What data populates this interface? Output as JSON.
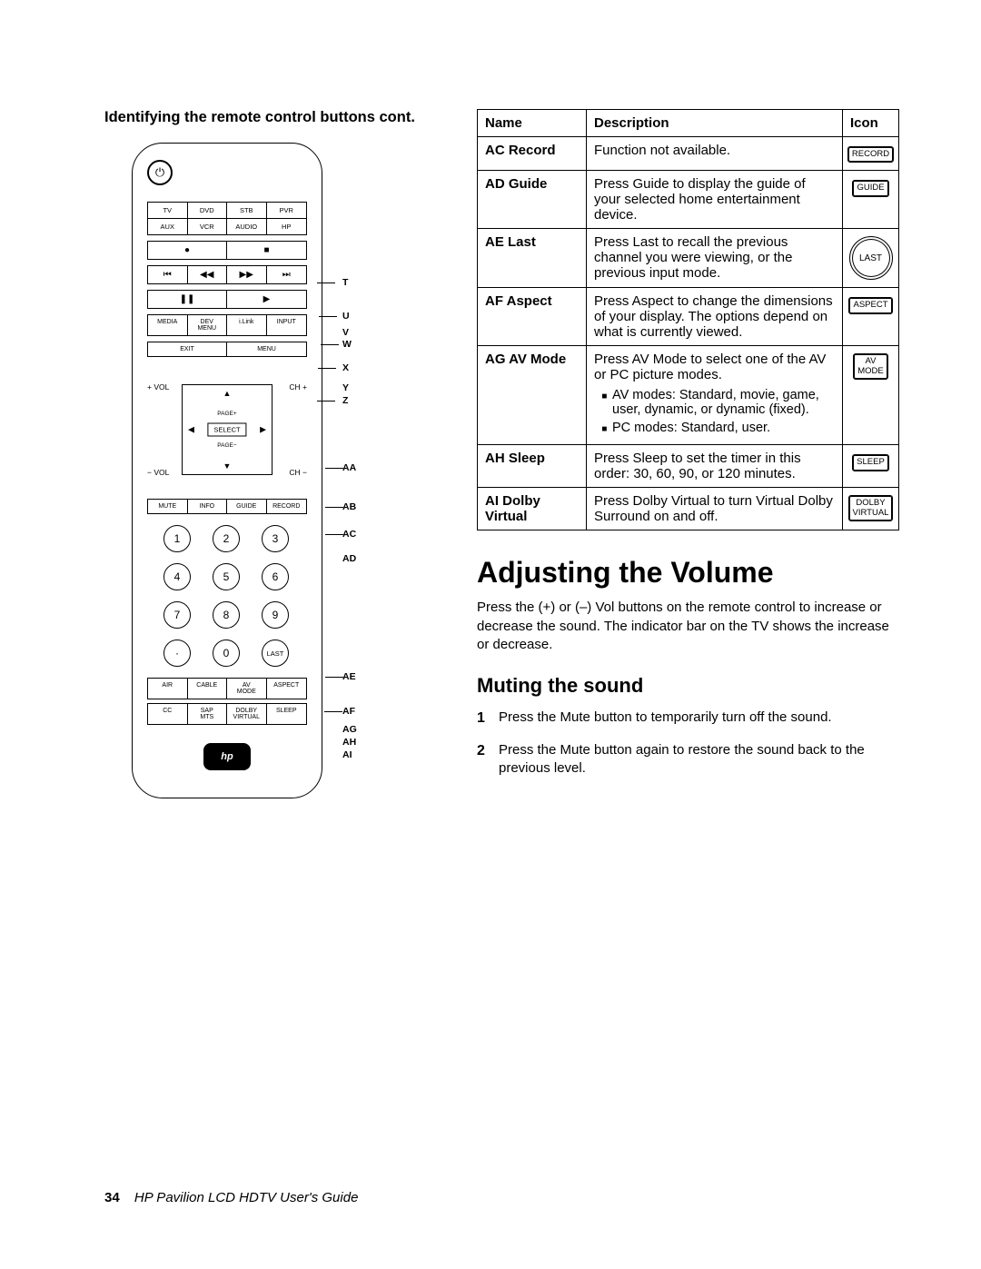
{
  "left": {
    "heading": "Identifying the remote control buttons cont.",
    "device_row1": [
      "TV",
      "DVD",
      "STB",
      "PVR"
    ],
    "device_row2": [
      "AUX",
      "VCR",
      "AUDIO",
      "HP"
    ],
    "rec_stop": [
      "●",
      "■"
    ],
    "transport": [
      "⏮",
      "◀◀",
      "▶▶",
      "⏭"
    ],
    "pause_play": [
      "❚❚",
      "▶"
    ],
    "media_row": [
      "MEDIA",
      "DEV\nMENU",
      "i.Link",
      "INPUT"
    ],
    "exit_menu": [
      "EXIT",
      "MENU"
    ],
    "vol_plus": "+ VOL",
    "vol_minus": "− VOL",
    "ch_plus": "CH +",
    "ch_minus": "CH −",
    "page_plus": "PAGE+",
    "page_minus": "PAGE−",
    "select": "SELECT",
    "info_row": [
      "MUTE",
      "INFO",
      "GUIDE",
      "RECORD"
    ],
    "numbers": [
      "1",
      "2",
      "3",
      "4",
      "5",
      "6",
      "7",
      "8",
      "9",
      "·",
      "0",
      "LAST"
    ],
    "bottom_row1": [
      "AIR",
      "CABLE",
      "AV\nMODE",
      "ASPECT"
    ],
    "bottom_row2": [
      "CC",
      "SAP\nMTS",
      "DOLBY\nVIRTUAL",
      "SLEEP"
    ],
    "callouts": [
      "T",
      "U",
      "V",
      "W",
      "X",
      "Y",
      "Z",
      "AA",
      "AB",
      "AC",
      "AD",
      "AE",
      "AF",
      "AG",
      "AH",
      "AI"
    ]
  },
  "table": {
    "head": [
      "Name",
      "Description",
      "Icon"
    ],
    "rows": [
      {
        "code": "AC",
        "name": "Record",
        "desc": "Function not available.",
        "icon": "RECORD",
        "shape": "rect"
      },
      {
        "code": "AD",
        "name": "Guide",
        "desc": "Press Guide to display the guide of your selected home entertainment device.",
        "icon": "GUIDE",
        "shape": "rect"
      },
      {
        "code": "AE",
        "name": "Last",
        "desc": "Press Last to recall the previous channel you were viewing, or the previous input mode.",
        "icon": "LAST",
        "shape": "circle"
      },
      {
        "code": "AF",
        "name": "Aspect",
        "desc": "Press Aspect to change the dimensions of your display. The options depend on what is currently viewed.",
        "icon": "ASPECT",
        "shape": "rect"
      },
      {
        "code": "AG",
        "name": "AV Mode",
        "desc": "Press AV Mode to select one of the AV or PC picture modes.",
        "icon": "AV\nMODE",
        "shape": "rect",
        "bullets": [
          "AV modes: Standard, movie, game, user, dynamic, or dynamic (fixed).",
          "PC modes: Standard, user."
        ]
      },
      {
        "code": "AH",
        "name": "Sleep",
        "desc": "Press Sleep to set the timer in this order: 30, 60, 90, or 120 minutes.",
        "icon": "SLEEP",
        "shape": "rect"
      },
      {
        "code": "AI",
        "name": "Dolby Virtual",
        "desc": "Press Dolby Virtual to turn Virtual Dolby Surround on and off.",
        "icon": "DOLBY\nVIRTUAL",
        "shape": "rect"
      }
    ]
  },
  "section": {
    "h1": "Adjusting the Volume",
    "p1": "Press the (+) or (–) Vol buttons on the remote control to increase or decrease the sound. The indicator bar on the TV shows the increase or decrease.",
    "h2": "Muting the sound",
    "steps": [
      {
        "n": "1",
        "t": "Press the Mute button to temporarily turn off the sound."
      },
      {
        "n": "2",
        "t": "Press the Mute button again to restore the sound back to the previous level."
      }
    ]
  },
  "footer": {
    "page": "34",
    "title": "HP Pavilion LCD HDTV User's Guide"
  }
}
